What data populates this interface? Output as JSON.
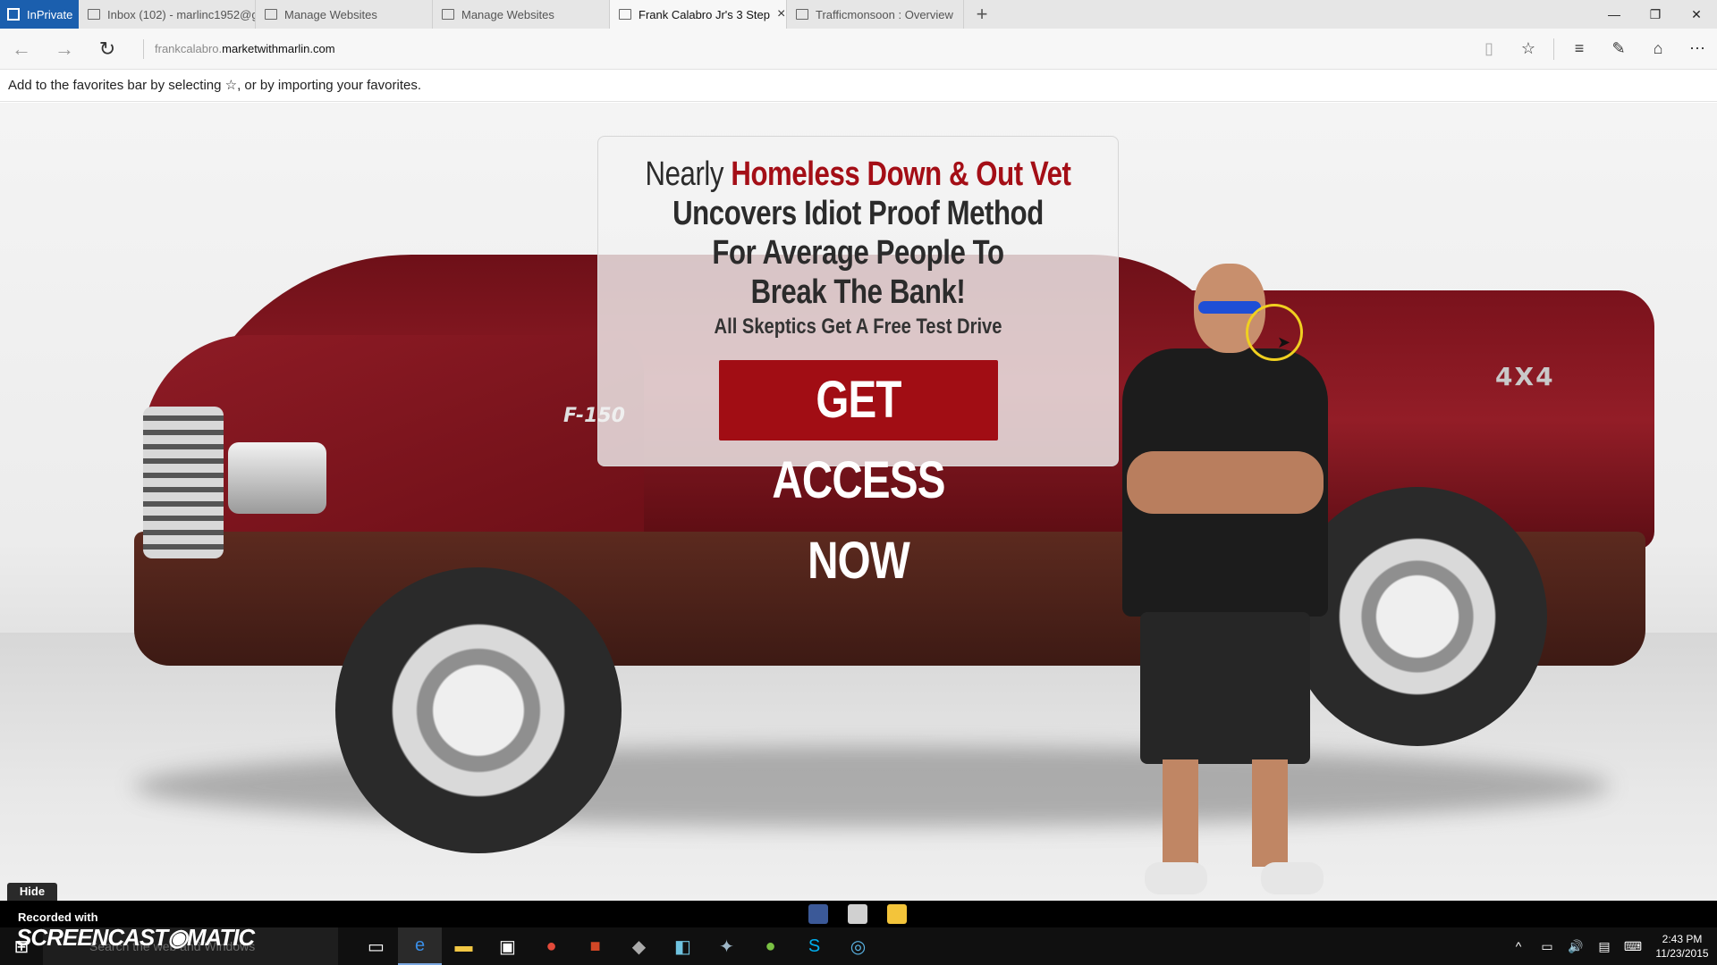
{
  "browser": {
    "inprivate_label": "InPrivate",
    "tabs": [
      {
        "title": "Inbox (102) - marlinc1952@g",
        "active": false
      },
      {
        "title": "Manage Websites",
        "active": false
      },
      {
        "title": "Manage Websites",
        "active": false
      },
      {
        "title": "Frank Calabro Jr's 3 Step",
        "active": true
      },
      {
        "title": "Trafficmonsoon : Overview",
        "active": false
      }
    ],
    "new_tab_icon": "+",
    "address": {
      "prefix": "frankcalabro.",
      "domain": "marketwithmarlin.com"
    },
    "favorites_hint": "Add to the favorites bar by selecting ☆, or by importing your favorites."
  },
  "page": {
    "headline_lead": "Nearly ",
    "headline_accent": "Homeless Down & Out Vet",
    "headline_line2": "Uncovers Idiot Proof Method",
    "headline_line3": "For Average People To",
    "headline_line4": "Break The Bank!",
    "subheadline": "All Skeptics Get A Free Test Drive",
    "cta_label": "GET ACCESS NOW",
    "badge_4x4": "4X4",
    "badge_f150": "F-150",
    "accent_color": "#a40e16"
  },
  "recorder": {
    "hide_label": "Hide",
    "recorded_with": "Recorded with",
    "logo_text": "SCREENCAST◉MATIC"
  },
  "taskbar": {
    "search_placeholder": "Search the web and Windows",
    "clock_time": "2:43 PM",
    "clock_date": "11/23/2015"
  }
}
